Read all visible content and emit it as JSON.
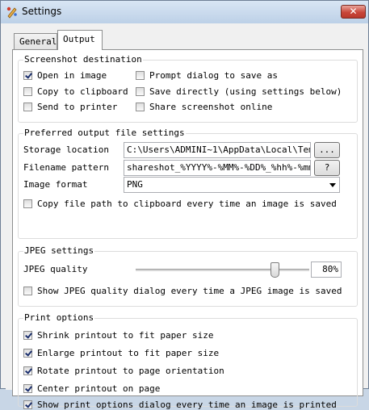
{
  "window": {
    "title": "Settings",
    "close_symbol": "✕"
  },
  "tabs": [
    {
      "label": "General",
      "active": false
    },
    {
      "label": "Output",
      "active": true
    }
  ],
  "screenshot_destination": {
    "title": "Screenshot destination",
    "options": [
      {
        "label": "Open in image",
        "checked": true
      },
      {
        "label": "Copy to clipboard",
        "checked": false
      },
      {
        "label": "Send to printer",
        "checked": false
      },
      {
        "label": "Prompt dialog to save as",
        "checked": false
      },
      {
        "label": "Save directly (using settings below)",
        "checked": false
      },
      {
        "label": "Share screenshot online",
        "checked": false
      }
    ]
  },
  "output_file": {
    "title": "Preferred output file settings",
    "storage_label": "Storage location",
    "storage_value": "C:\\Users\\ADMINI~1\\AppData\\Local\\Temp\\S",
    "browse_label": "...",
    "filename_label": "Filename pattern",
    "filename_value": "shareshot_%YYYY%-%MM%-%DD%_%hh%-%mm%-%",
    "help_label": "?",
    "format_label": "Image format",
    "format_value": "PNG",
    "copy_path_label": "Copy file path to clipboard every time an image is saved",
    "copy_path_checked": false
  },
  "jpeg": {
    "title": "JPEG settings",
    "quality_label": "JPEG quality",
    "quality_value": 80,
    "quality_text": "80%",
    "show_dialog_label": "Show JPEG quality dialog every time a JPEG image is saved",
    "show_dialog_checked": false
  },
  "print": {
    "title": "Print options",
    "options": [
      {
        "label": "Shrink printout to fit paper size",
        "checked": true
      },
      {
        "label": "Enlarge printout to fit paper size",
        "checked": true
      },
      {
        "label": "Rotate printout to page orientation",
        "checked": true
      },
      {
        "label": "Center printout on page",
        "checked": true
      },
      {
        "label": "Show print options dialog every time an image is printed",
        "checked": true
      }
    ]
  }
}
